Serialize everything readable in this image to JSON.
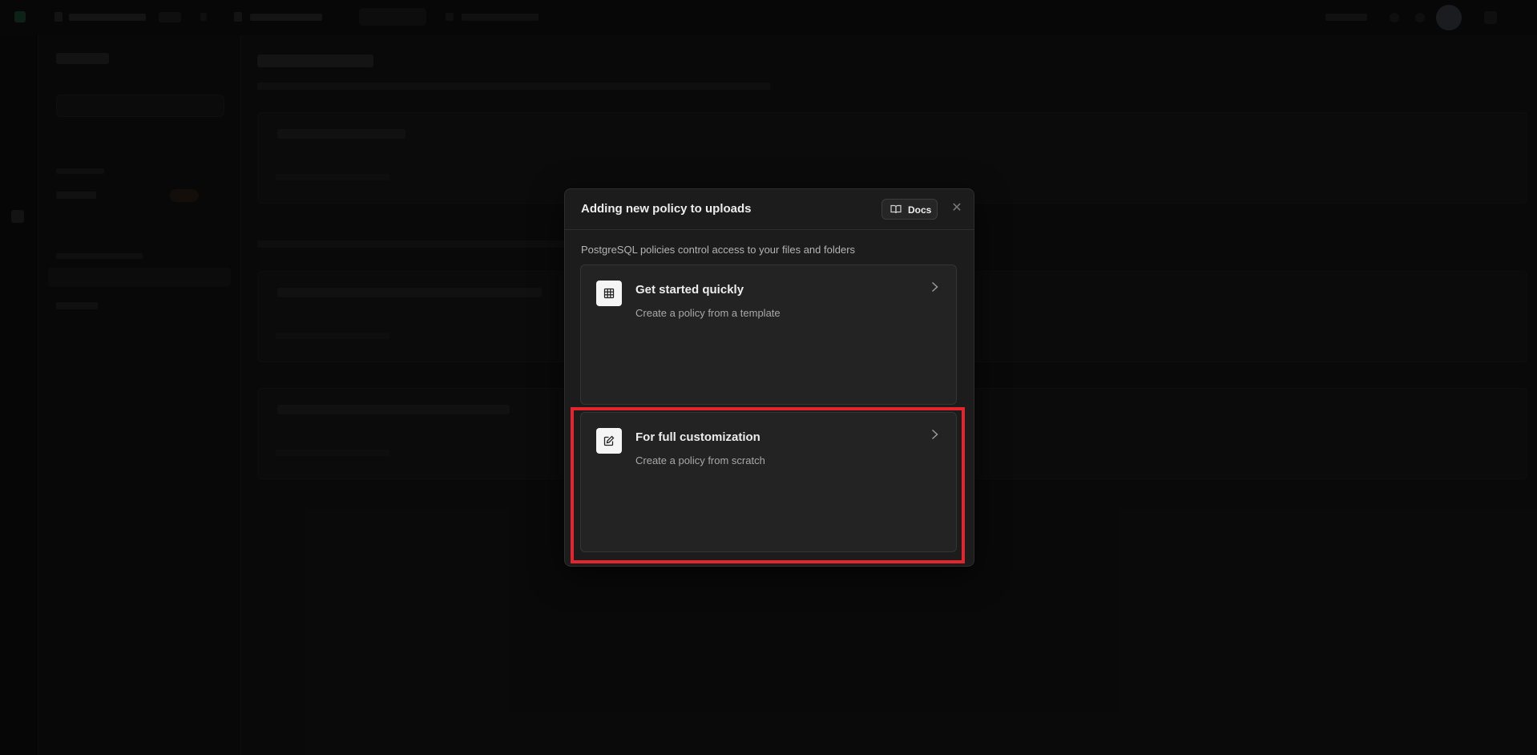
{
  "modal": {
    "title": "Adding new policy to uploads",
    "docs_label": "Docs",
    "description": "PostgreSQL policies control access to your files and folders",
    "options": [
      {
        "title": "Get started quickly",
        "subtitle": "Create a policy from a template",
        "icon": "table-grid-icon"
      },
      {
        "title": "For full customization",
        "subtitle": "Create a policy from scratch",
        "icon": "edit-icon"
      }
    ]
  },
  "highlight_color": "#e3252e"
}
